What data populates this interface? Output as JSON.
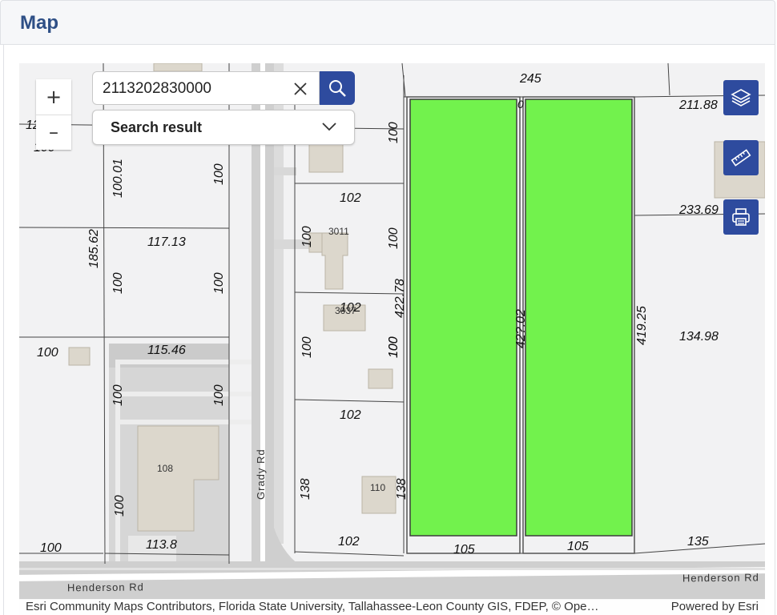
{
  "header": {
    "title": "Map"
  },
  "search": {
    "value": "2113202830000",
    "result_label": "Search result"
  },
  "zoom": {
    "in_label": "+",
    "out_label": "–"
  },
  "tools": [
    "layers-icon",
    "measure-icon",
    "print-icon"
  ],
  "colors": {
    "accent": "#2e4b9e",
    "parcel_highlight": "#72f24d",
    "title": "#2e4f86"
  },
  "map": {
    "roads": [
      "Grady Rd",
      "Henderson Rd",
      "Henderson Rd"
    ],
    "dimensions": [
      "245",
      "0",
      "211.88",
      "233.69",
      "134.98",
      "419.25",
      "42?.02",
      "422.78",
      "100",
      "100",
      "102",
      "100",
      "100",
      "102",
      "100",
      "100",
      "102",
      "138",
      "138",
      "102",
      "105",
      "105",
      "135",
      "117.13",
      "100.01",
      "100",
      "185.62",
      "100",
      "100",
      "100",
      "115.46",
      "100",
      "100",
      "100",
      "113.8",
      "100",
      "100",
      "12"
    ],
    "addresses": [
      "3011",
      "3037",
      "108",
      "110"
    ]
  },
  "attribution": {
    "text": "Esri Community Maps Contributors, Florida State University, Tallahassee-Leon County GIS, FDEP, © Ope…",
    "powered_by": "Powered by Esri"
  }
}
